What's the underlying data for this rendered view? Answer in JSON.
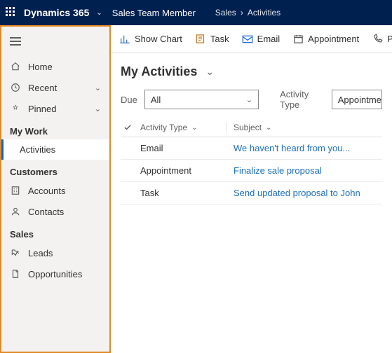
{
  "topbar": {
    "brand": "Dynamics 365",
    "subapp": "Sales Team Member",
    "crumbs": [
      "Sales",
      "Activities"
    ]
  },
  "sidebar": {
    "top": [
      {
        "id": "home",
        "label": "Home"
      },
      {
        "id": "recent",
        "label": "Recent",
        "expandable": true
      },
      {
        "id": "pinned",
        "label": "Pinned",
        "expandable": true
      }
    ],
    "groups": [
      {
        "title": "My Work",
        "items": [
          {
            "id": "activities",
            "label": "Activities",
            "active": true
          }
        ]
      },
      {
        "title": "Customers",
        "items": [
          {
            "id": "accounts",
            "label": "Accounts"
          },
          {
            "id": "contacts",
            "label": "Contacts"
          }
        ]
      },
      {
        "title": "Sales",
        "items": [
          {
            "id": "leads",
            "label": "Leads"
          },
          {
            "id": "opportunities",
            "label": "Opportunities"
          }
        ]
      }
    ]
  },
  "cmdbar": {
    "show_chart": "Show Chart",
    "task": "Task",
    "email": "Email",
    "appointment": "Appointment",
    "phone_call": "Phone Call"
  },
  "page": {
    "title": "My Activities",
    "due_label": "Due",
    "due_value": "All",
    "activity_type_label": "Activity Type",
    "activity_type_value": "Appointment,C"
  },
  "grid": {
    "headers": {
      "activity_type": "Activity Type",
      "subject": "Subject"
    },
    "rows": [
      {
        "type": "Email",
        "subject": "We haven't heard from you..."
      },
      {
        "type": "Appointment",
        "subject": "Finalize sale proposal"
      },
      {
        "type": "Task",
        "subject": "Send updated proposal to John"
      }
    ]
  }
}
